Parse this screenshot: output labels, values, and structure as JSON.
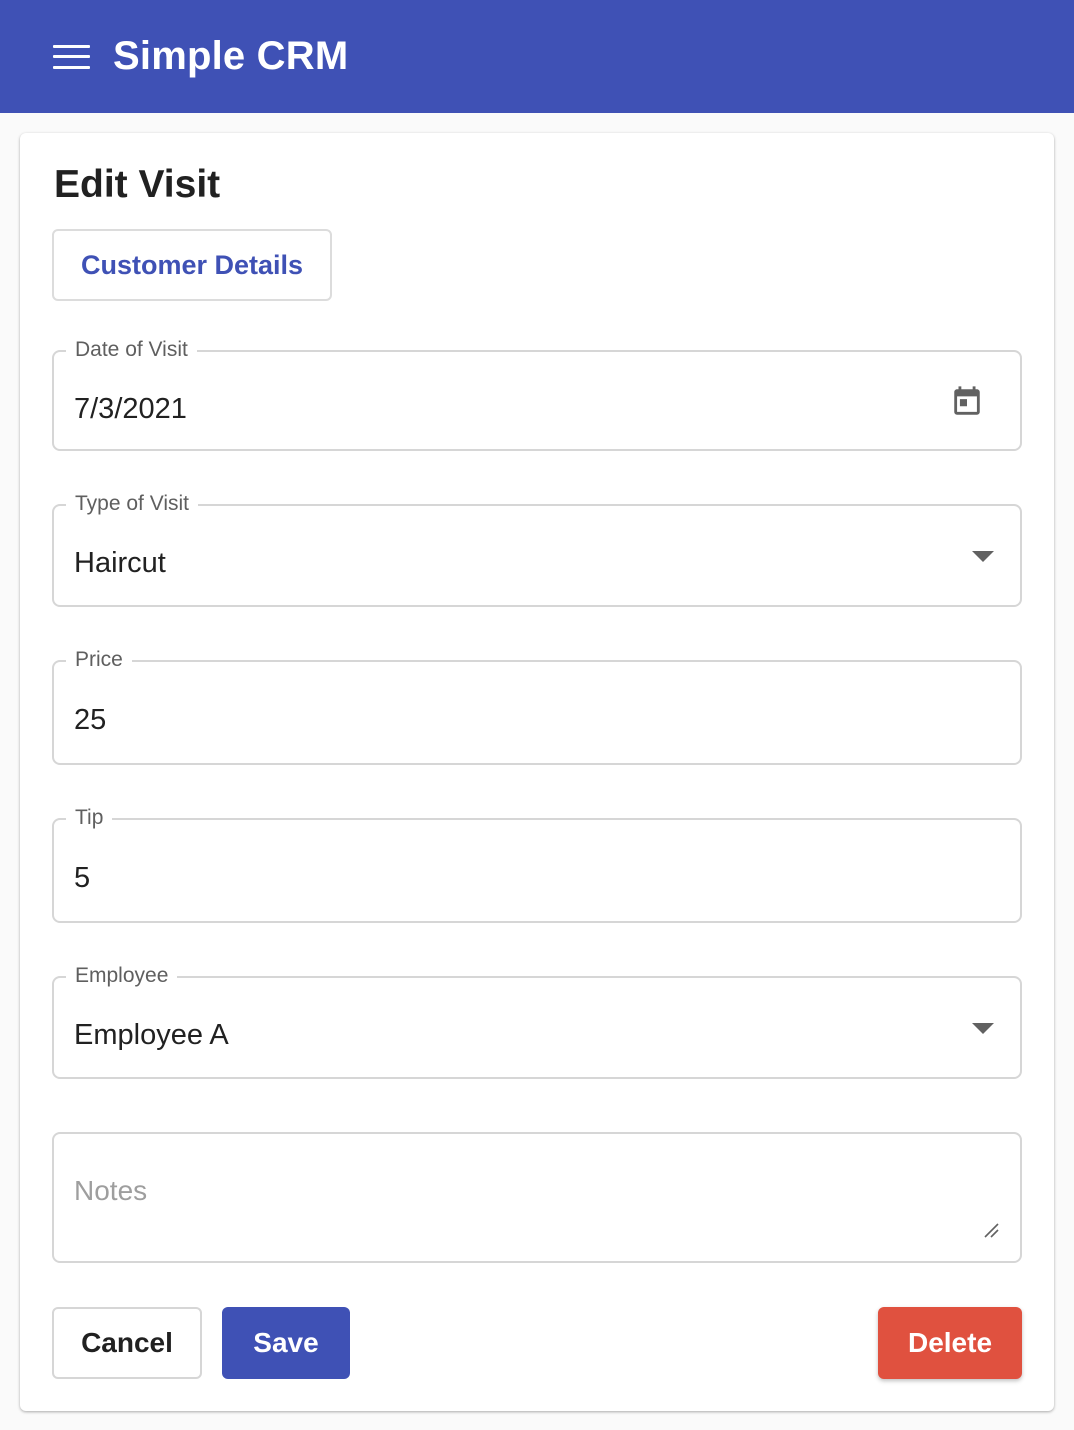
{
  "app": {
    "title": "Simple CRM"
  },
  "page": {
    "title": "Edit Visit",
    "customer_details_label": "Customer Details"
  },
  "form": {
    "date_of_visit": {
      "label": "Date of Visit",
      "value": "7/3/2021"
    },
    "type_of_visit": {
      "label": "Type of Visit",
      "value": "Haircut"
    },
    "price": {
      "label": "Price",
      "value": "25"
    },
    "tip": {
      "label": "Tip",
      "value": "5"
    },
    "employee": {
      "label": "Employee",
      "value": "Employee A"
    },
    "notes": {
      "placeholder": "Notes",
      "value": ""
    }
  },
  "actions": {
    "cancel_label": "Cancel",
    "save_label": "Save",
    "delete_label": "Delete"
  },
  "icons": {
    "menu": "hamburger-menu-icon",
    "calendar": "calendar-icon",
    "dropdown": "arrow-drop-down-icon",
    "resize": "resize-handle-icon"
  },
  "colors": {
    "primary": "#3f51b5",
    "danger": "#e0513f",
    "background": "#fafafa",
    "surface": "#ffffff"
  }
}
